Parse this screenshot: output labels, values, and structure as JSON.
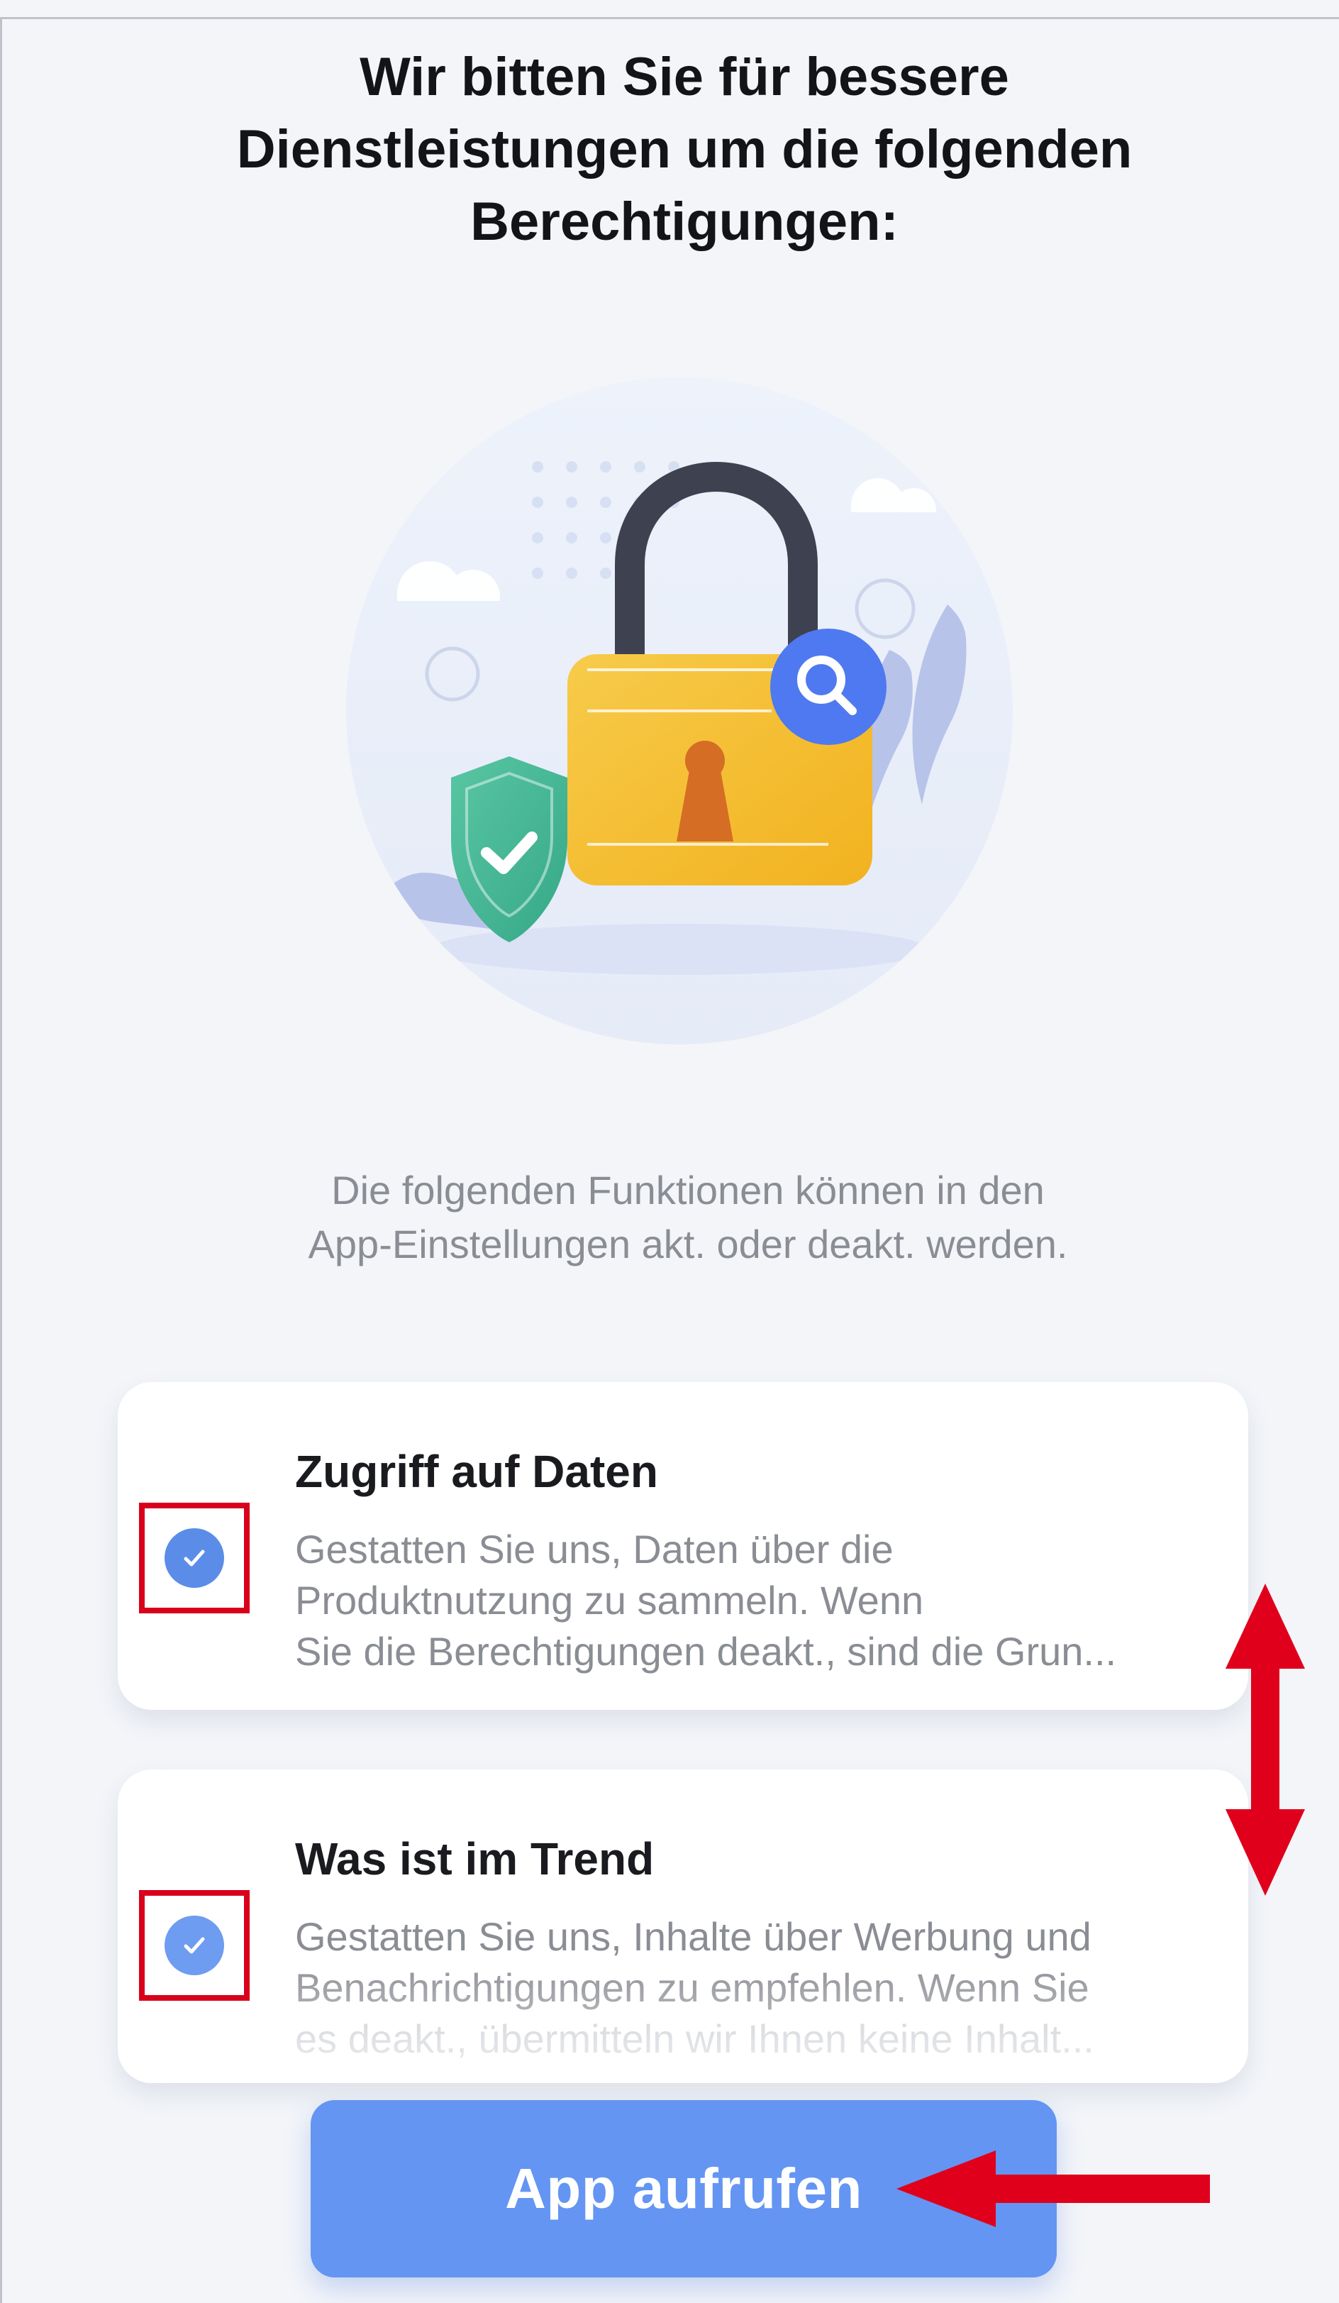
{
  "header": {
    "title_lines": [
      "Wir bitten Sie für bessere",
      "Dienstleistungen um die folgenden",
      "Berechtigungen:"
    ]
  },
  "illustration": {
    "icons": [
      "padlock-icon",
      "shield-icon",
      "magnifier-icon",
      "checkmark-icon",
      "cloud-icon",
      "leaf-icon"
    ]
  },
  "intro": {
    "lines": [
      "Die folgenden Funktionen können in den",
      "App-Einstellungen akt. oder deakt. werden."
    ]
  },
  "permissions": [
    {
      "title": "Zugriff auf Daten",
      "checked": true,
      "description_lines": [
        "Gestatten Sie uns, Daten über die",
        "Produktnutzung zu sammeln. Wenn",
        "Sie die Berechtigungen deakt., sind die Grun..."
      ]
    },
    {
      "title": "Was ist im Trend",
      "checked": true,
      "description_lines": [
        "Gestatten Sie uns, Inhalte über Werbung und",
        "Benachrichtigungen zu empfehlen. Wenn Sie",
        "es deakt., übermitteln wir Ihnen keine Inhalt..."
      ]
    }
  ],
  "actions": {
    "primary_label": "App aufrufen"
  },
  "colors": {
    "background": "#f3f5f9",
    "title": "#121418",
    "secondary_text": "#8a8d93",
    "primary_button": "#6495f2",
    "checkbox": "#5b8de8",
    "annotation_red": "#d9001b"
  }
}
